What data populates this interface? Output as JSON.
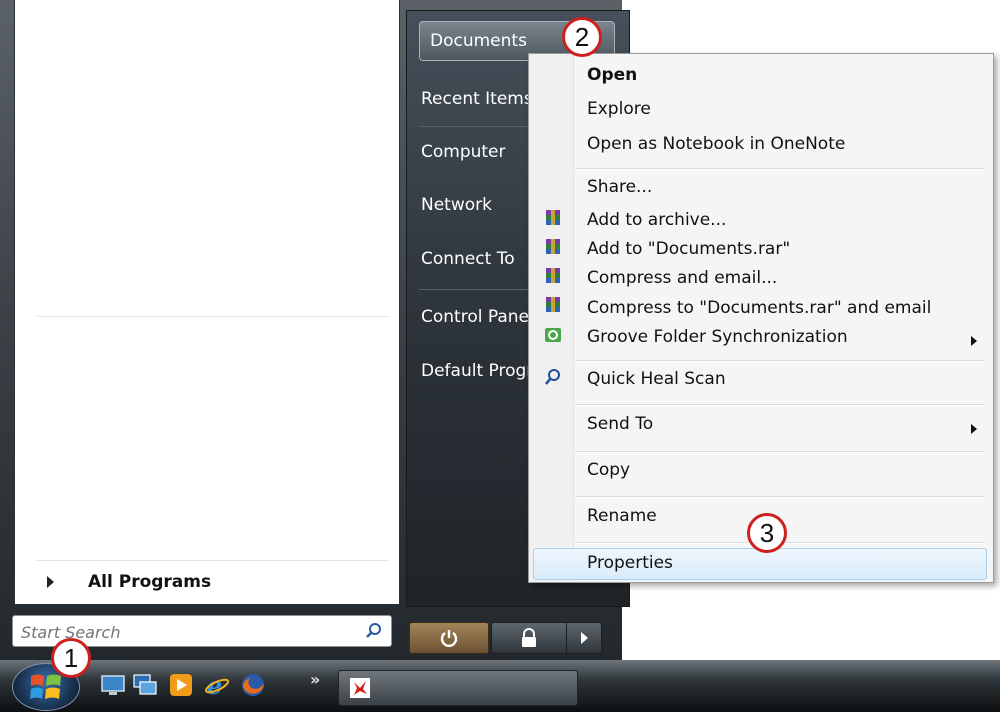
{
  "start_menu": {
    "all_programs_label": "All Programs",
    "search_placeholder": "Start Search",
    "right_items": [
      {
        "label": "Documents"
      },
      {
        "label": "Recent Items"
      },
      {
        "label": "Computer"
      },
      {
        "label": "Network"
      },
      {
        "label": "Connect To"
      },
      {
        "label": "Control Panel"
      },
      {
        "label": "Default Programs"
      }
    ]
  },
  "context_menu": {
    "items": [
      {
        "label": "Open",
        "bold": true
      },
      {
        "label": "Explore"
      },
      {
        "label": "Open as Notebook in OneNote"
      },
      {
        "label": "Share..."
      },
      {
        "label": "Add to archive...",
        "icon": "winrar-icon"
      },
      {
        "label": "Add to \"Documents.rar\"",
        "icon": "winrar-icon"
      },
      {
        "label": "Compress and email...",
        "icon": "winrar-icon"
      },
      {
        "label": "Compress to \"Documents.rar\" and email",
        "icon": "winrar-icon"
      },
      {
        "label": "Groove Folder Synchronization",
        "icon": "groove-icon",
        "submenu": true
      },
      {
        "label": "Quick Heal Scan",
        "icon": "quick-heal-icon"
      },
      {
        "label": "Send To",
        "submenu": true
      },
      {
        "label": "Copy"
      },
      {
        "label": "Rename"
      },
      {
        "label": "Properties",
        "highlighted": true
      }
    ]
  },
  "callouts": [
    "1",
    "2",
    "3"
  ],
  "colors": {
    "callout_border": "#cf2020",
    "menu_highlight": "#d9ebf9",
    "dark_pane": "#2b3238"
  }
}
